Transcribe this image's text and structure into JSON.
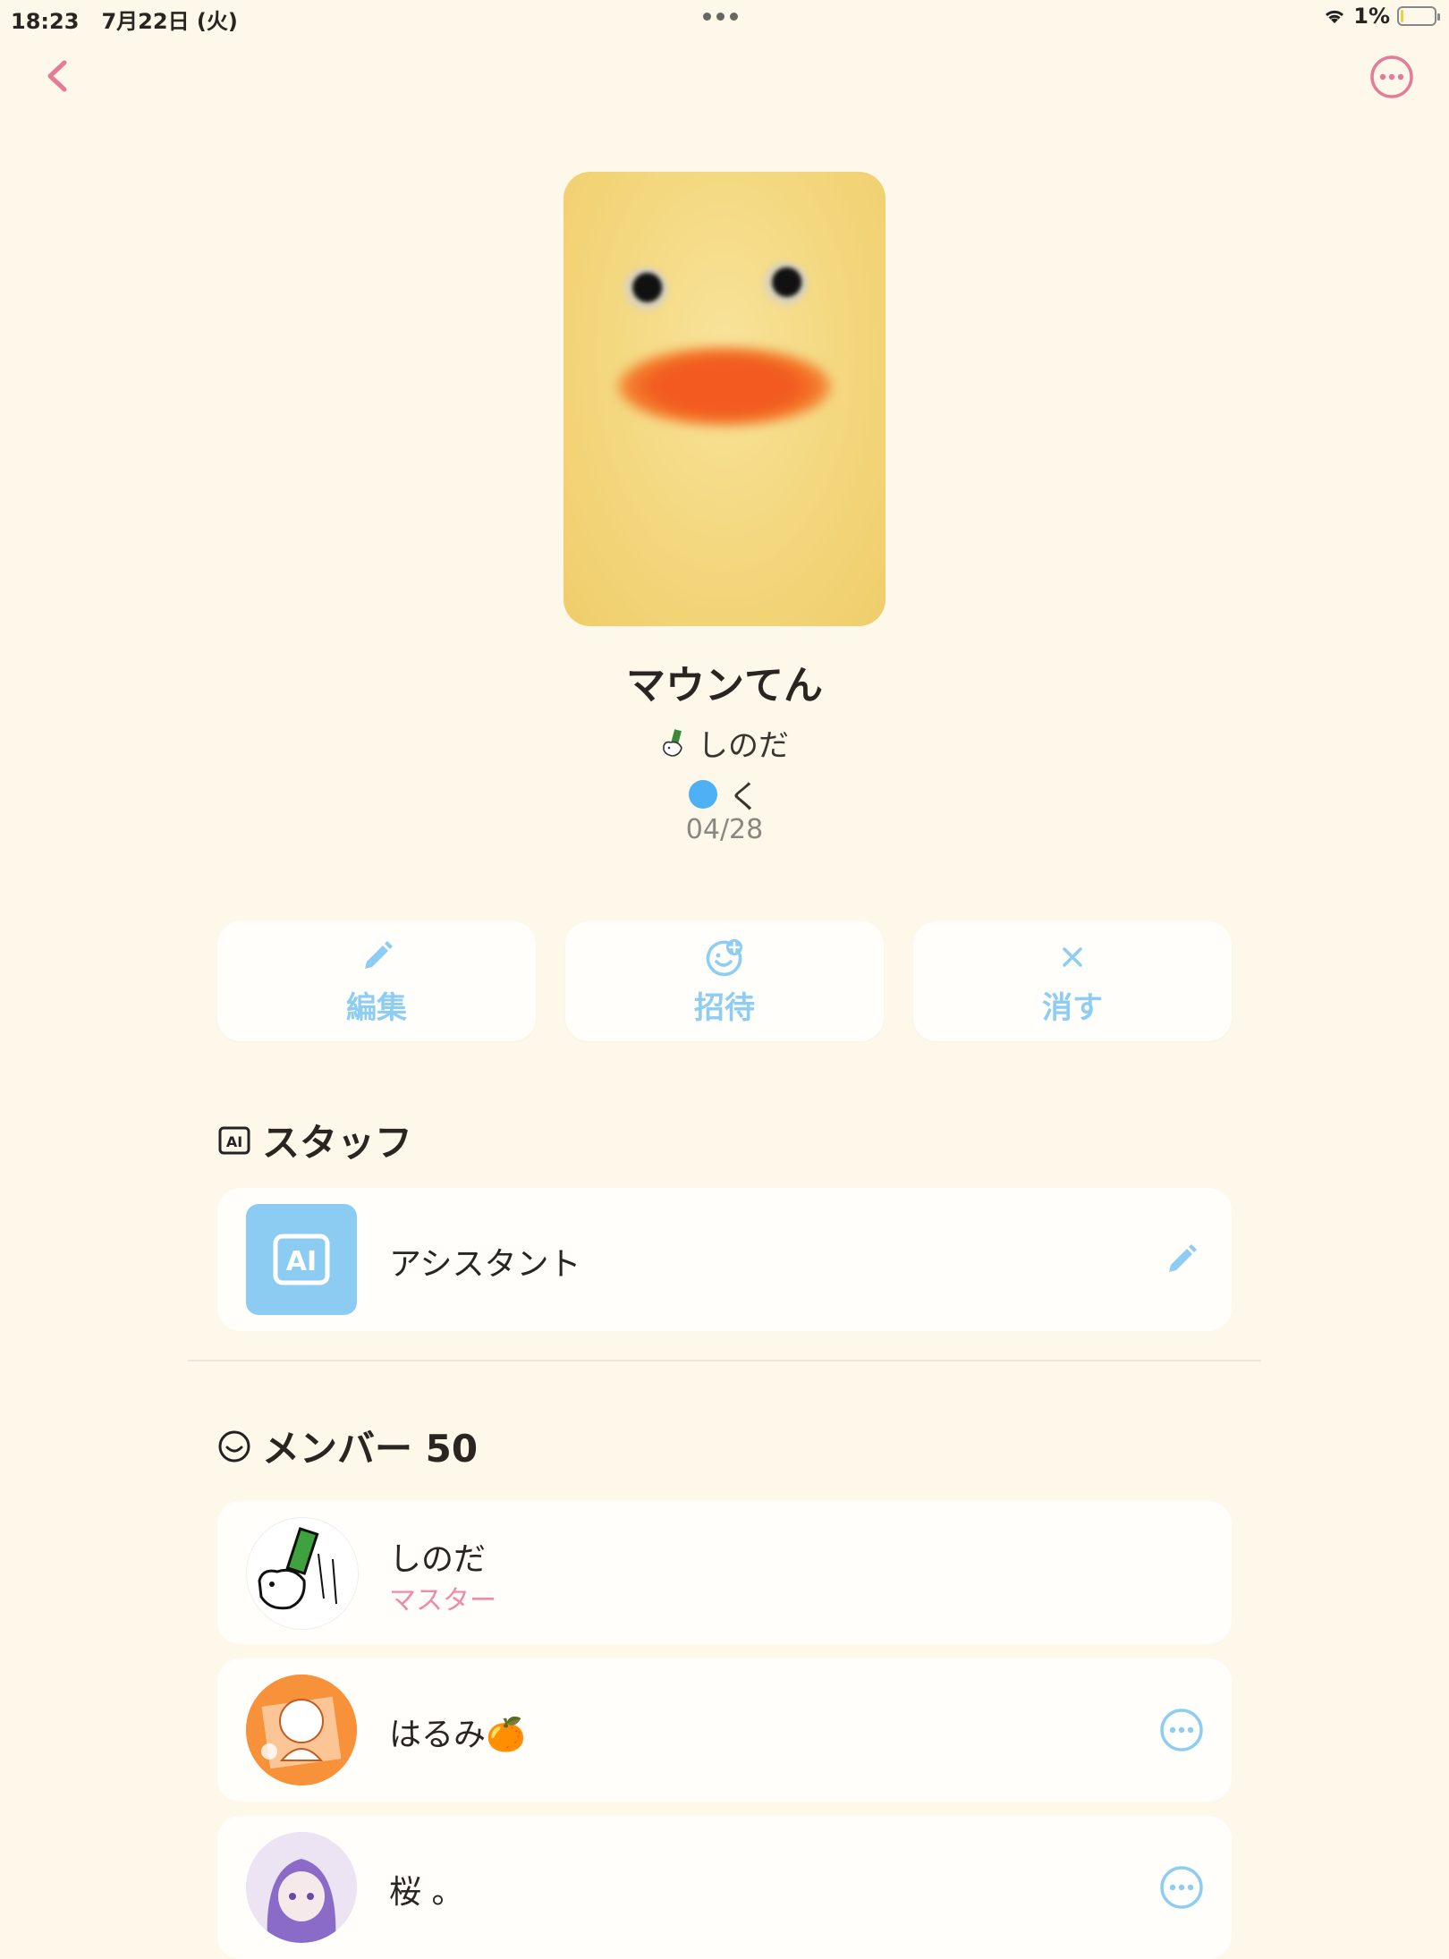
{
  "status_bar": {
    "time": "18:23",
    "date": "7月22日 (火)",
    "battery": "1%"
  },
  "group": {
    "name": "マウンてん",
    "owner": "しのだ",
    "tag": "く",
    "date": "04/28"
  },
  "actions": {
    "edit_label": "編集",
    "invite_label": "招待",
    "delete_label": "消す"
  },
  "staff": {
    "title": "スタッフ",
    "assistant_name": "アシスタント"
  },
  "members": {
    "title": "メンバー 50",
    "list": [
      {
        "name": "しのだ",
        "role": "マスター"
      },
      {
        "name": "はるみ🍊",
        "role": ""
      },
      {
        "name": "桜 。",
        "role": ""
      }
    ]
  },
  "colors": {
    "background": "#fdf8ea",
    "accent_blue": "#8ecdf3",
    "accent_pink": "#e57b96"
  }
}
